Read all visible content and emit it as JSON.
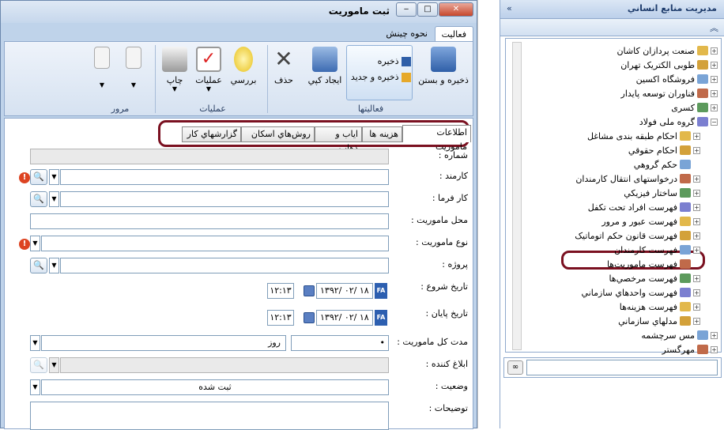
{
  "window": {
    "title": "ثبت ماموريت",
    "minimize_glyph": "‒",
    "maximize_glyph": "□",
    "close_glyph": "✕"
  },
  "ribbon": {
    "tabs": [
      {
        "label": "فعاليت"
      },
      {
        "label": "نحوه چينش"
      }
    ],
    "buttons": {
      "save_close": "ذخيره و بستن",
      "save": "ذخيره",
      "save_new": "ذخيره و جديد",
      "create_copy": "ايجاد کپي",
      "delete": "حذف",
      "review": "بررسي",
      "operations": "عمليات",
      "print": "چاپ"
    },
    "groups": {
      "activities": "فعاليتها",
      "operations": "عمليات",
      "browse": "مرور"
    }
  },
  "form": {
    "tabs": [
      {
        "label": "اطلاعات ماموريت"
      },
      {
        "label": "هزينه ها"
      },
      {
        "label": "اياب و ذهاب"
      },
      {
        "label": "روش‌هاي اسکان"
      },
      {
        "label": "گزارشهاي کار"
      }
    ],
    "fields": {
      "number": "شماره :",
      "employee": "کارمند :",
      "employer": "کار فرما :",
      "location": "محل ماموريت :",
      "mission_type": "نوع ماموريت :",
      "project": "پروژه :",
      "start_date": "تاريخ شروع :",
      "end_date": "تاريخ پايان :",
      "duration": "مدت کل ماموريت :",
      "notifier": "ابلاغ کننده :",
      "status": "وضعيت :",
      "description": "توضيحات :"
    },
    "values": {
      "start_time": "۱۲:۱۳",
      "start_date": "۱۳۹۲/ ۰۲/ ۱۸",
      "end_time": "۱۲:۱۳",
      "end_date": "۱۳۹۲/ ۰۲/ ۱۸",
      "duration_value": "•",
      "duration_unit": "روز",
      "status": "ثبت شده",
      "fa_badge": "FA"
    }
  },
  "right_panel": {
    "title": "مديريت منابع انساني",
    "tree": [
      {
        "label": "صنعت پردازان کاشان",
        "level": 0,
        "expander": "+"
      },
      {
        "label": "طوبی الکتريک تهران",
        "level": 0,
        "expander": "+"
      },
      {
        "label": "فروشگاه اکسين",
        "level": 0,
        "expander": "+"
      },
      {
        "label": "فناوران توسعه پايدار",
        "level": 0,
        "expander": "+"
      },
      {
        "label": "کسری",
        "level": 0,
        "expander": "+"
      },
      {
        "label": "گروه ملی فولاد",
        "level": 0,
        "expander": "−"
      },
      {
        "label": "احکام طبقه بندی مشاغل",
        "level": 1,
        "expander": "+"
      },
      {
        "label": "احکام حقوقي",
        "level": 1,
        "expander": "+"
      },
      {
        "label": "حکم گروهي",
        "level": 1,
        "expander": ""
      },
      {
        "label": "درخواستهای انتقال کارمندان",
        "level": 1,
        "expander": "+"
      },
      {
        "label": "ساختار فيزيکي",
        "level": 1,
        "expander": "+"
      },
      {
        "label": "فهرست افراد تحت تکفل",
        "level": 1,
        "expander": "+"
      },
      {
        "label": "فهرست عبور و مرور",
        "level": 1,
        "expander": "+"
      },
      {
        "label": "فهرست قانون حکم اتوماتيک",
        "level": 1,
        "expander": "+"
      },
      {
        "label": "فهرست کارمندان",
        "level": 1,
        "expander": "+"
      },
      {
        "label": "فهرست ماموريت‌ها",
        "level": 1,
        "expander": ""
      },
      {
        "label": "فهرست مرخصي‌ها",
        "level": 1,
        "expander": "+"
      },
      {
        "label": "فهرست واحدهاي سازماني",
        "level": 1,
        "expander": "+"
      },
      {
        "label": "فهرست هزينه‌ها",
        "level": 1,
        "expander": "+"
      },
      {
        "label": "مدلهاي سازماني",
        "level": 1,
        "expander": "+"
      },
      {
        "label": "مس سرچشمه",
        "level": 0,
        "expander": "+"
      },
      {
        "label": "مهرگستر",
        "level": 0,
        "expander": "+"
      }
    ]
  },
  "colors": {
    "highlight": "#7a1020",
    "ribbon_bg": "#d6e2f1",
    "fa_badge": "#2d5fb0"
  }
}
